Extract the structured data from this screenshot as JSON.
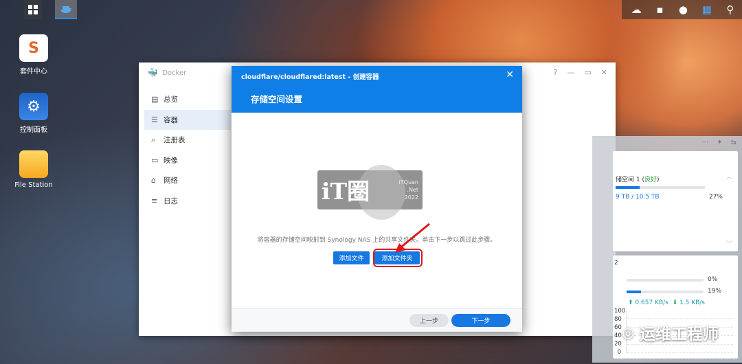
{
  "desktop": {
    "icons": [
      {
        "label": "套件中心",
        "glyph": "S"
      },
      {
        "label": "控制面板",
        "glyph": "⚙"
      },
      {
        "label": "File Station",
        "glyph": ""
      }
    ]
  },
  "taskbar": {
    "tray_icons": [
      "cloud-check-icon",
      "chat-icon",
      "user-icon",
      "widgets-icon",
      "search-icon"
    ]
  },
  "docker": {
    "title": "Docker",
    "sidebar": [
      {
        "label": "总览",
        "icon": "▤"
      },
      {
        "label": "容器",
        "icon": "☰"
      },
      {
        "label": "注册表",
        "icon": "⌕"
      },
      {
        "label": "映像",
        "icon": "▭"
      },
      {
        "label": "网络",
        "icon": "⌂"
      },
      {
        "label": "日志",
        "icon": "≡"
      }
    ]
  },
  "dialog": {
    "title": "cloudflare/cloudflared:latest - 创建容器",
    "step_title": "存储空间设置",
    "description": "将容器的存储空间映射到 Synology NAS 上的共享文件夹。单击下一步以跳过此步骤。",
    "add_file": "添加文件",
    "add_folder": "添加文件夹",
    "prev": "上一步",
    "next": "下一步",
    "watermark": {
      "main": "iT圈",
      "line1": "iTQuan",
      "line2": ".Net",
      "line3": "2022"
    }
  },
  "widgets": {
    "storage": {
      "volume_prefix": "储空间 1 (",
      "status": "良好",
      "volume_suffix": ")",
      "size": "9 TB / 10.5 TB",
      "percent": "27%",
      "fill_percent": 27
    },
    "resource": {
      "heading": "2",
      "cpu_percent": "0%",
      "cpu_fill": 0,
      "ram_percent": "19%",
      "ram_fill": 19,
      "upload": "0.657 KB/s",
      "download": "1.5 KB/s",
      "axis": [
        "100",
        "80",
        "60",
        "40",
        "20",
        "0"
      ]
    }
  },
  "wechat": {
    "text": "运维工程师"
  }
}
